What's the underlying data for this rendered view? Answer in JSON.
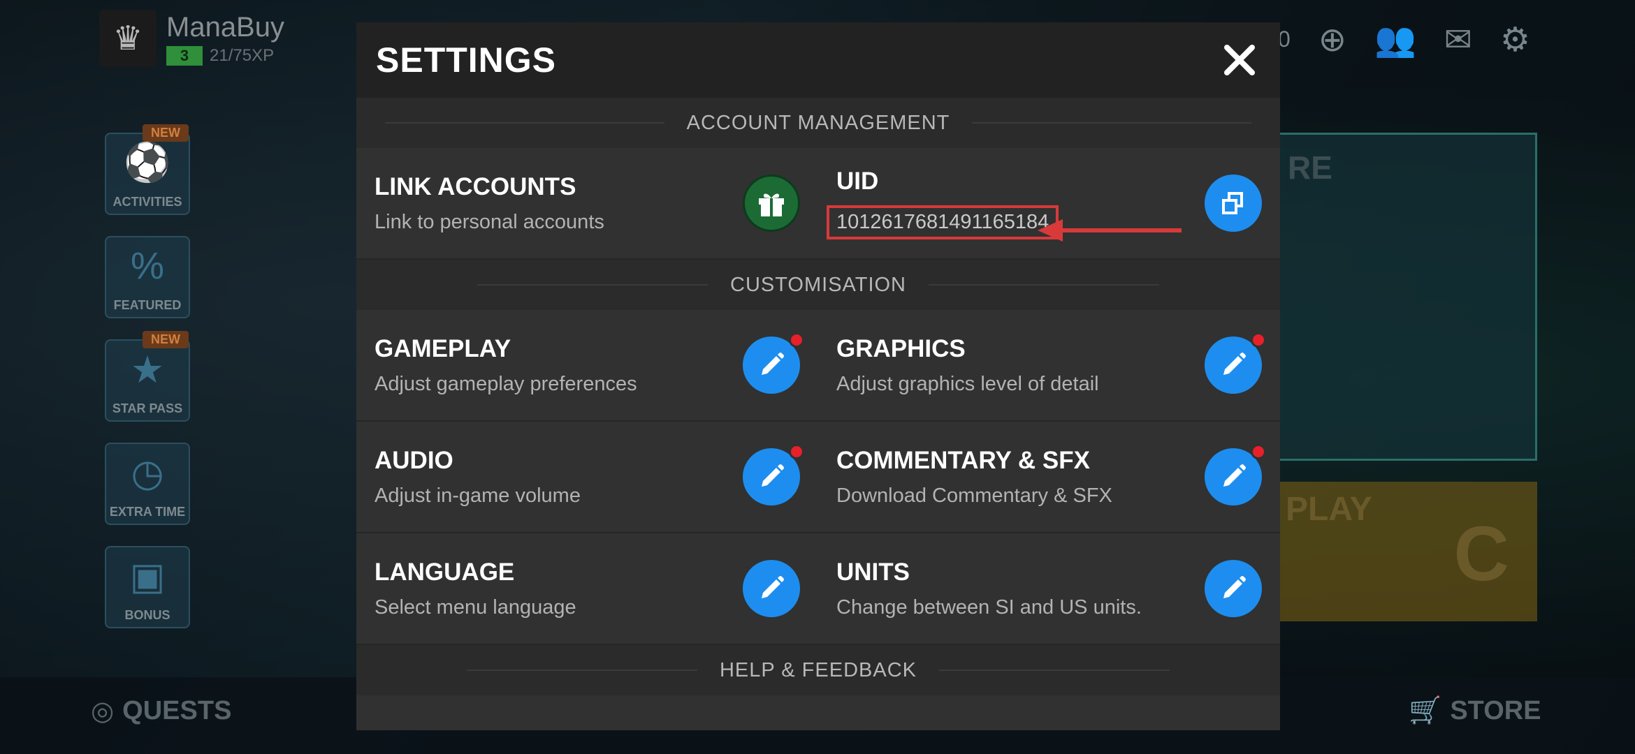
{
  "background": {
    "profile": {
      "name": "ManaBuy",
      "level": "3",
      "xp": "21/75XP",
      "badge_icon": "club-crest-icon"
    },
    "side_menu": [
      {
        "label": "ACTIVITIES",
        "badge": "NEW",
        "icon": "ball-icon"
      },
      {
        "label": "FEATURED",
        "badge": "",
        "icon": "gift-percent-icon"
      },
      {
        "label": "STAR PASS",
        "badge": "NEW",
        "icon": "star-icon"
      },
      {
        "label": "EXTRA TIME",
        "badge": "",
        "icon": "clock-icon"
      },
      {
        "label": "BONUS",
        "badge": "",
        "icon": "box-icon"
      }
    ],
    "top_right": {
      "coins": "0",
      "icons": [
        "friends-icon",
        "mail-icon",
        "gear-icon"
      ]
    },
    "banner_text": "RE",
    "play_text": "PLAY",
    "play_letter": "C",
    "bottom_bar": {
      "quests_label": "QUESTS",
      "store_label": "STORE"
    }
  },
  "modal": {
    "title": "SETTINGS",
    "sections": {
      "account": {
        "title": "ACCOUNT MANAGEMENT",
        "link_title": "LINK ACCOUNTS",
        "link_sub": "Link to personal accounts",
        "uid_title": "UID",
        "uid_value": "1012617681491165184"
      },
      "custom": {
        "title": "CUSTOMISATION",
        "gameplay_title": "GAMEPLAY",
        "gameplay_sub": "Adjust gameplay preferences",
        "graphics_title": "GRAPHICS",
        "graphics_sub": "Adjust graphics level of detail",
        "audio_title": "AUDIO",
        "audio_sub": "Adjust in-game volume",
        "commentary_title": "COMMENTARY & SFX",
        "commentary_sub": "Download Commentary & SFX",
        "language_title": "LANGUAGE",
        "language_sub": "Select menu language",
        "units_title": "UNITS",
        "units_sub": "Change between SI and US units."
      },
      "help": {
        "title": "HELP & FEEDBACK"
      }
    },
    "colors": {
      "accent_blue": "#1d8ef0",
      "notification_red": "#e8202a",
      "highlight_red": "#d83a3a"
    }
  }
}
